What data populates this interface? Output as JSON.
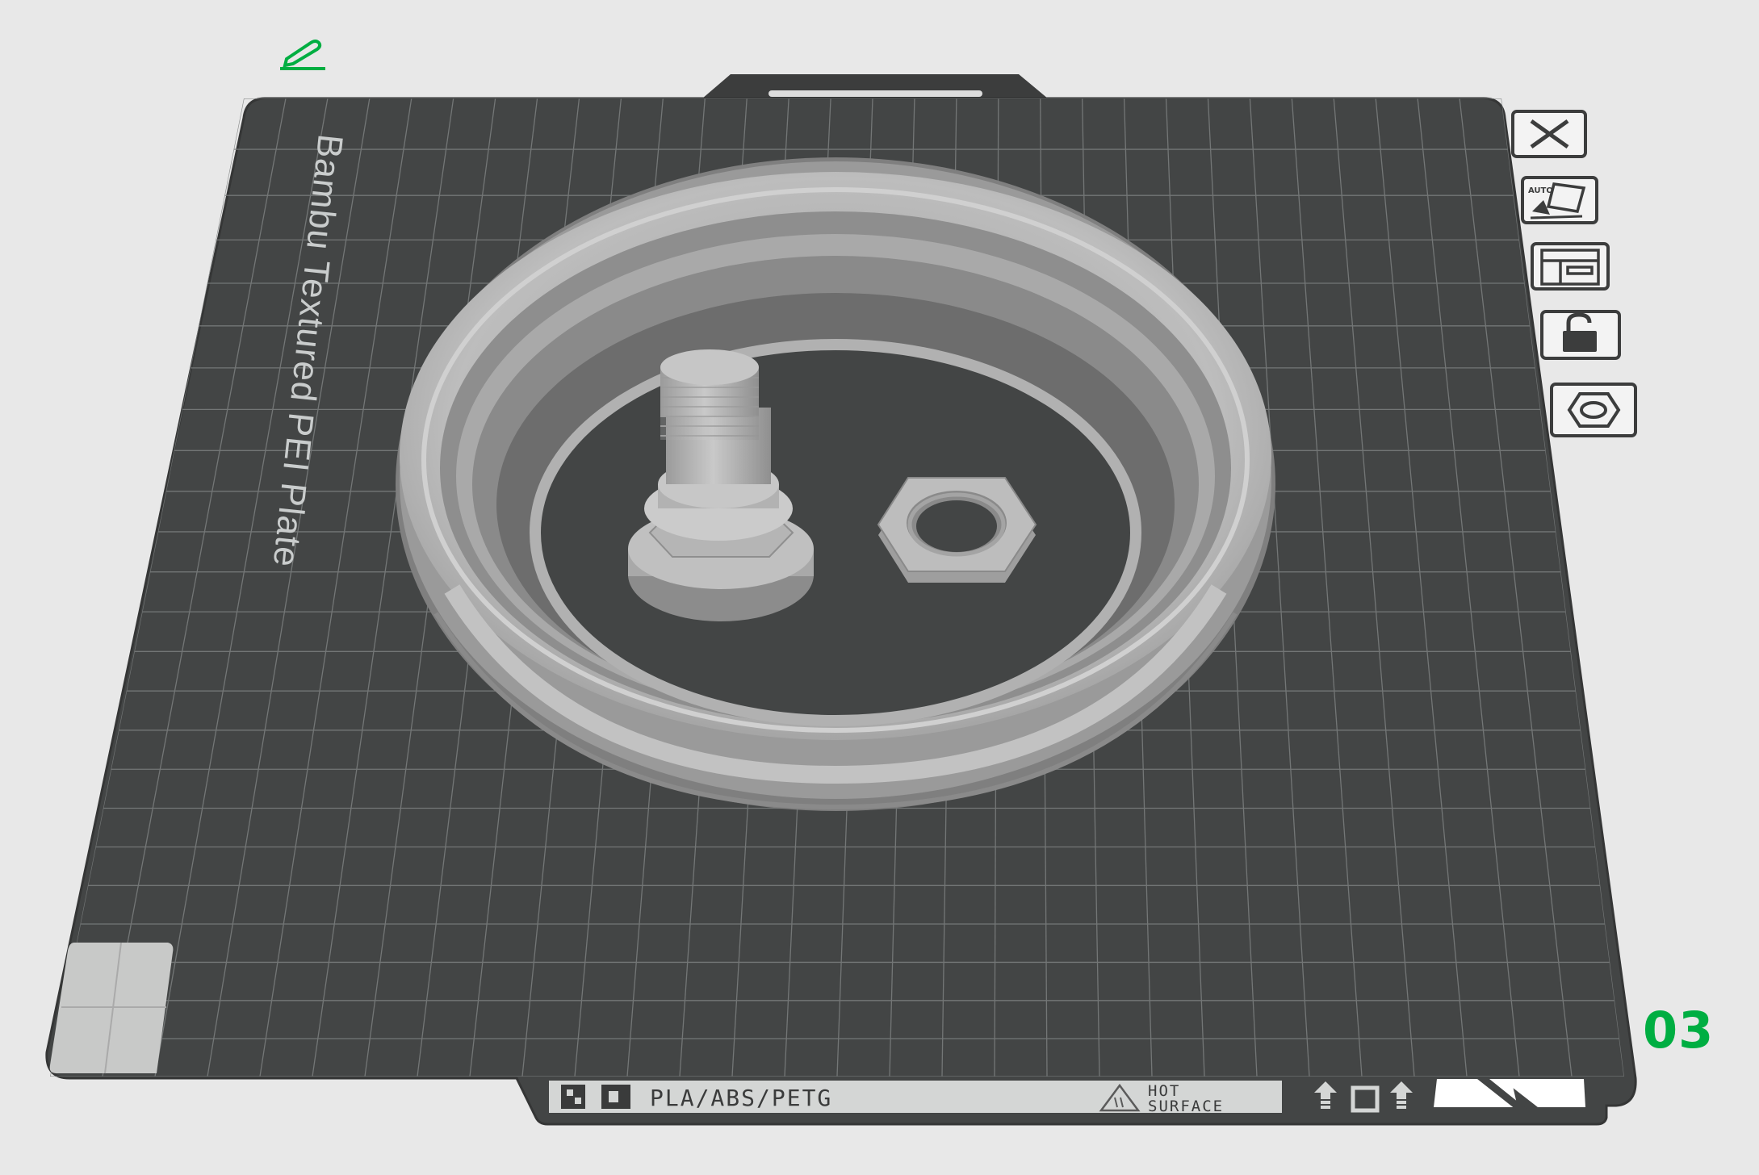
{
  "plate": {
    "name": "Bambu Textured PEI Plate",
    "number": "03",
    "material_label": "PLA/ABS/PETG",
    "warning_line1": "HOT",
    "warning_line2": "SURFACE"
  },
  "tools": [
    {
      "id": "delete",
      "icon": "close-icon"
    },
    {
      "id": "auto-orient",
      "icon": "auto-orient-icon",
      "text": "AUTO"
    },
    {
      "id": "arrange",
      "icon": "arrange-icon"
    },
    {
      "id": "lock",
      "icon": "unlock-icon"
    },
    {
      "id": "plate-settings",
      "icon": "hex-nut-icon"
    }
  ],
  "colors": {
    "accent": "#00ae42",
    "plate": "#434545",
    "plate_edge": "#3a3b3b",
    "grid": "#7c7f7f",
    "model": "#b8b8b8",
    "background": "#e8e8e8"
  }
}
